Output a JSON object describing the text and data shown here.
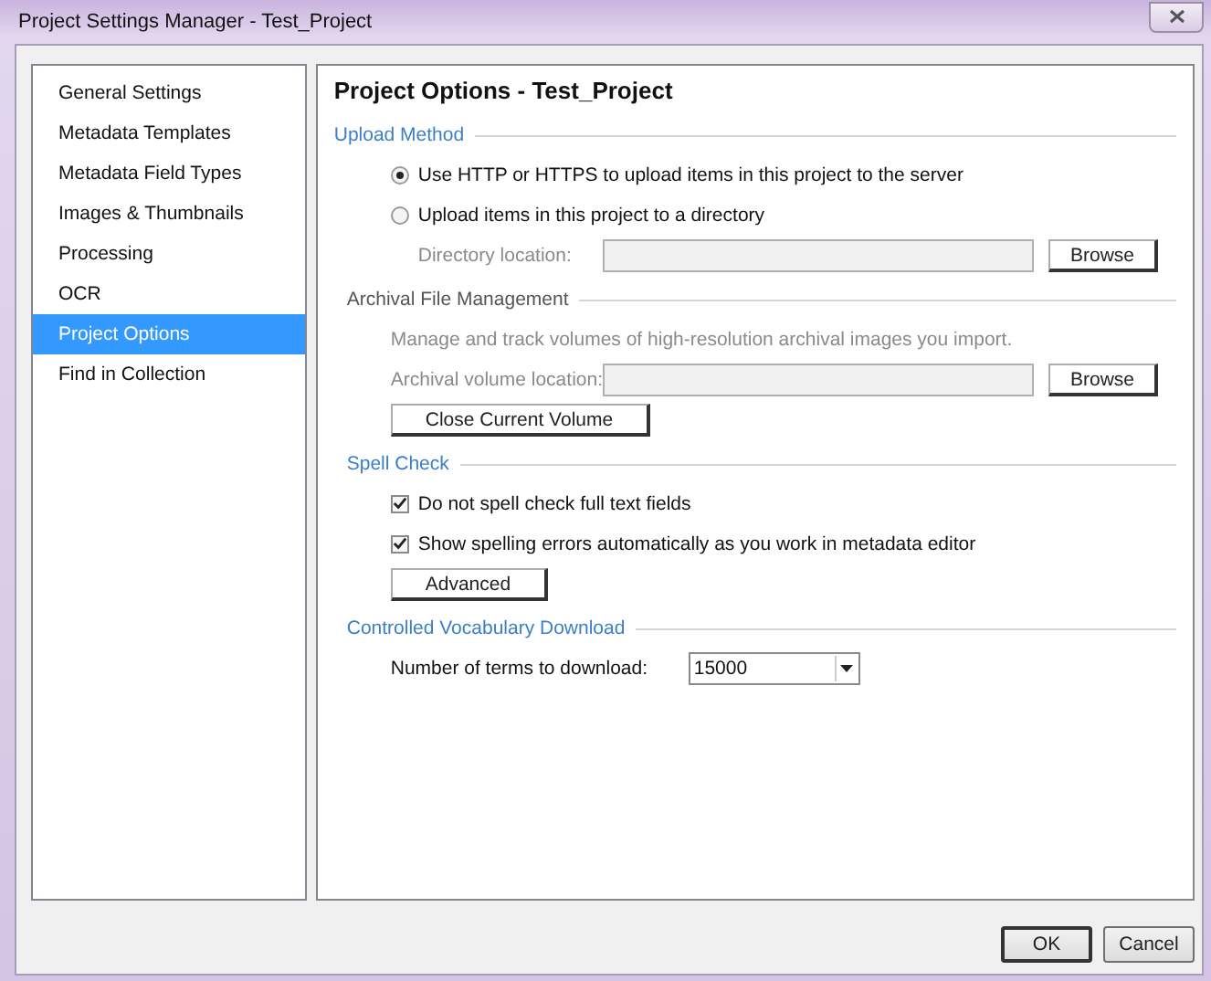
{
  "window": {
    "title": "Project Settings Manager - Test_Project"
  },
  "sidebar": {
    "items": [
      {
        "label": "General Settings",
        "selected": false
      },
      {
        "label": "Metadata Templates",
        "selected": false
      },
      {
        "label": "Metadata Field Types",
        "selected": false
      },
      {
        "label": "Images & Thumbnails",
        "selected": false
      },
      {
        "label": "Processing",
        "selected": false
      },
      {
        "label": "OCR",
        "selected": false
      },
      {
        "label": "Project Options",
        "selected": true
      },
      {
        "label": "Find in Collection",
        "selected": false
      }
    ]
  },
  "panel": {
    "title": "Project Options - Test_Project",
    "sections": [
      {
        "title": "Upload Method",
        "disabled": false,
        "rows": [
          {
            "kind": "radio",
            "label": "Use HTTP or HTTPS to upload items in this project to the server",
            "selected": true
          },
          {
            "kind": "radio",
            "label": "Upload items in this project to a directory",
            "selected": false
          },
          {
            "kind": "field",
            "label": "Directory location:",
            "disabled": true,
            "button": "Browse"
          }
        ]
      },
      {
        "title": "Archival File Management",
        "disabled": true,
        "rows": [
          {
            "kind": "text",
            "label": "Manage and track volumes of high-resolution archival images you import."
          },
          {
            "kind": "field",
            "label": "Archival volume location:",
            "disabled": true,
            "button": "Browse"
          },
          {
            "kind": "button",
            "label": "Close Current Volume"
          }
        ]
      },
      {
        "title": "Spell Check",
        "disabled": false,
        "rows": [
          {
            "kind": "checkbox",
            "label": "Do not spell check full text fields",
            "checked": true
          },
          {
            "kind": "checkbox",
            "label": "Show spelling errors automatically as you work in metadata editor",
            "checked": true
          },
          {
            "kind": "button",
            "label": "Advanced"
          }
        ]
      },
      {
        "title": "Controlled Vocabulary Download",
        "disabled": false,
        "rows": [
          {
            "kind": "dropdown",
            "label": "Number of terms to download:",
            "value": "15000"
          }
        ]
      }
    ]
  },
  "buttons": [
    {
      "label": "OK",
      "default": true
    },
    {
      "label": "Cancel",
      "default": false
    }
  ]
}
